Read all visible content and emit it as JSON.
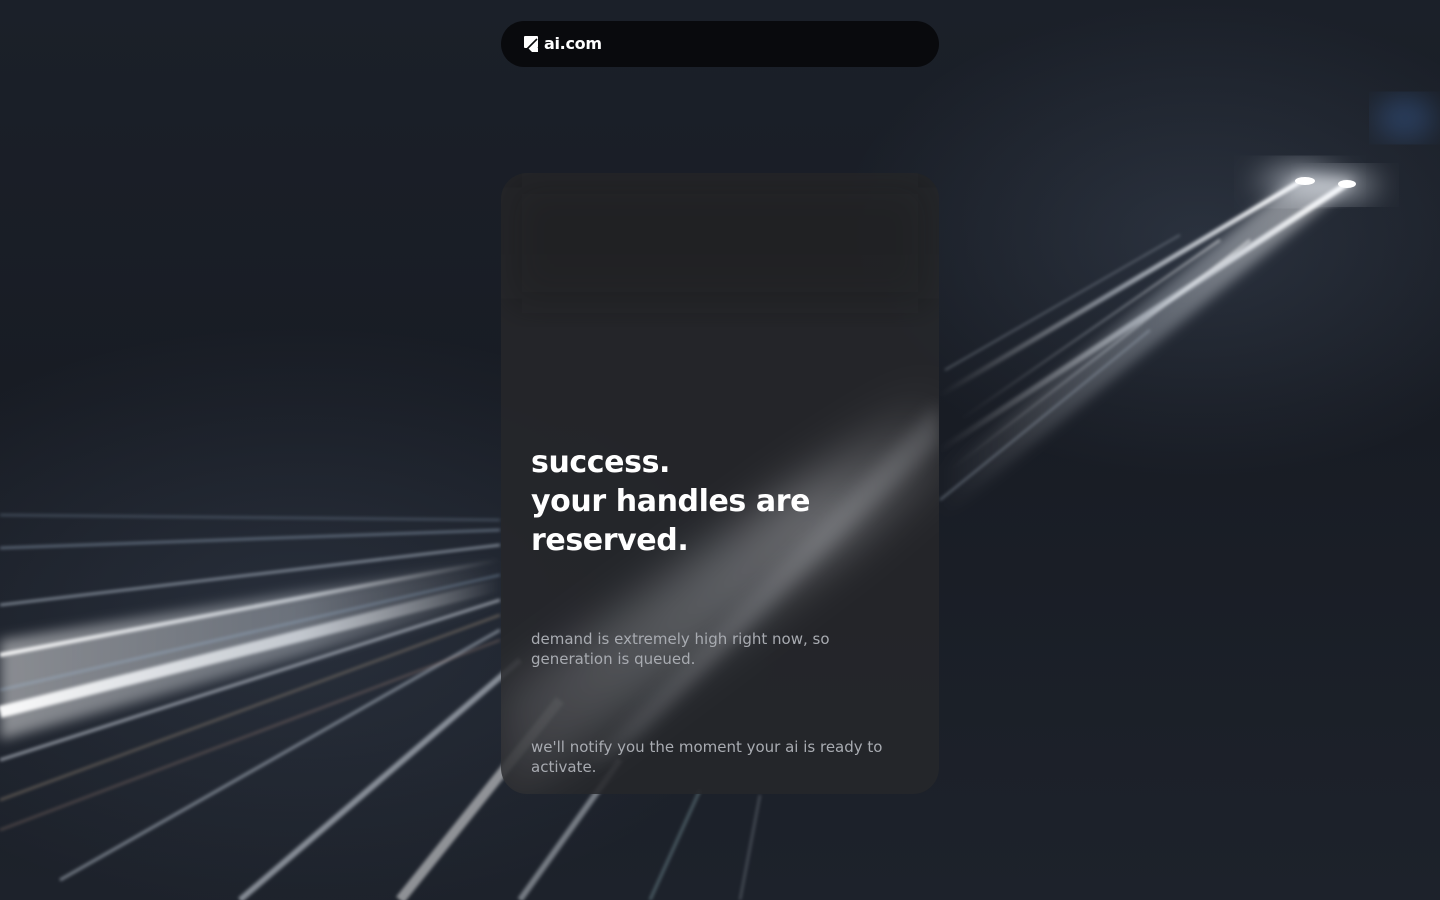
{
  "brand": {
    "name": "ai.com",
    "icon": "ai-logo-mark-icon"
  },
  "card": {
    "headline": [
      "success.",
      "your handles are",
      "reserved."
    ],
    "paragraphs": [
      "demand is extremely high right now, so generation is queued.",
      "we'll notify you the moment your ai is ready to activate."
    ]
  },
  "colors": {
    "background": "#15181f",
    "navbar": "#08090b",
    "card": "#26272a",
    "headline_text": "#ffffff",
    "body_text": "#a8abb1"
  }
}
